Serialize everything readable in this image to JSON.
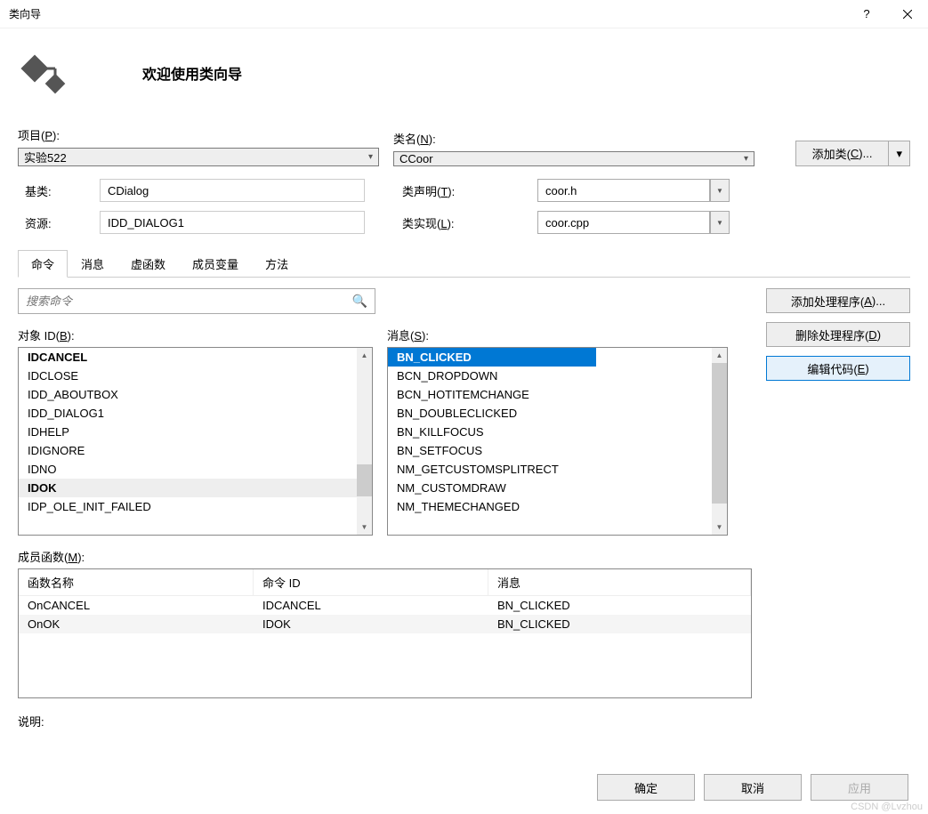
{
  "window": {
    "title": "类向导"
  },
  "header": {
    "title": "欢迎使用类向导"
  },
  "project": {
    "label": "项目(P):",
    "value": "实验522"
  },
  "classname": {
    "label": "类名(N):",
    "value": "CCoor"
  },
  "addclass": {
    "label": "添加类(C)..."
  },
  "baseclass": {
    "label": "基类:",
    "value": "CDialog"
  },
  "classdecl": {
    "label": "类声明(T):",
    "value": "coor.h"
  },
  "resource": {
    "label": "资源:",
    "value": "IDD_DIALOG1"
  },
  "classimpl": {
    "label": "类实现(L):",
    "value": "coor.cpp"
  },
  "tabs": [
    "命令",
    "消息",
    "虚函数",
    "成员变量",
    "方法"
  ],
  "search": {
    "placeholder": "搜索命令"
  },
  "objectid": {
    "label": "对象 ID(B):",
    "items": [
      {
        "text": "IDCANCEL",
        "bold": true
      },
      {
        "text": "IDCLOSE"
      },
      {
        "text": "IDD_ABOUTBOX"
      },
      {
        "text": "IDD_DIALOG1"
      },
      {
        "text": "IDHELP"
      },
      {
        "text": "IDIGNORE"
      },
      {
        "text": "IDNO"
      },
      {
        "text": "IDOK",
        "bold": true,
        "cursor": true
      },
      {
        "text": "IDP_OLE_INIT_FAILED"
      }
    ]
  },
  "messages": {
    "label": "消息(S):",
    "items": [
      {
        "text": "BN_CLICKED",
        "selected": true,
        "bold": true
      },
      {
        "text": "BCN_DROPDOWN"
      },
      {
        "text": "BCN_HOTITEMCHANGE"
      },
      {
        "text": "BN_DOUBLECLICKED"
      },
      {
        "text": "BN_KILLFOCUS"
      },
      {
        "text": "BN_SETFOCUS"
      },
      {
        "text": "NM_GETCUSTOMSPLITRECT"
      },
      {
        "text": "NM_CUSTOMDRAW"
      },
      {
        "text": "NM_THEMECHANGED"
      }
    ]
  },
  "member": {
    "label": "成员函数(M):",
    "headers": [
      "函数名称",
      "命令 ID",
      "消息"
    ],
    "rows": [
      [
        "OnCANCEL",
        "IDCANCEL",
        "BN_CLICKED"
      ],
      [
        "OnOK",
        "IDOK",
        "BN_CLICKED"
      ]
    ]
  },
  "sidebuttons": {
    "add_handler": "添加处理程序(A)...",
    "delete_handler": "删除处理程序(D)",
    "edit_code": "编辑代码(E)"
  },
  "description": {
    "label": "说明:"
  },
  "footer": {
    "ok": "确定",
    "cancel": "取消",
    "apply": "应用"
  },
  "watermark": "CSDN @Lvzhou"
}
